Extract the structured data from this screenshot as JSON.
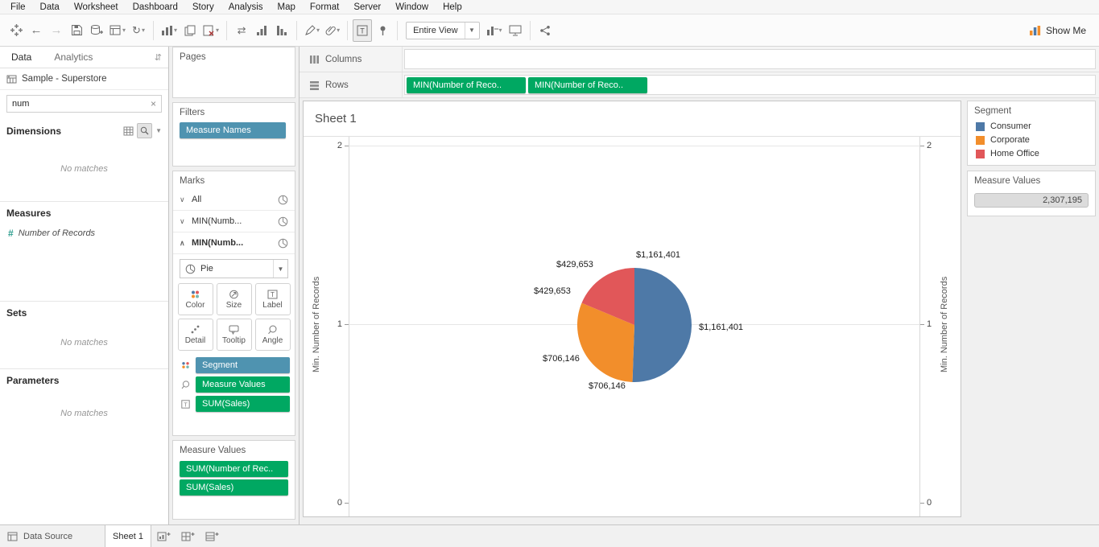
{
  "colors": {
    "pill_green": "#00a862",
    "pill_blue": "#4f93b0",
    "consumer": "#4e79a7",
    "corporate": "#f28e2b",
    "home_office": "#e15759"
  },
  "menu": {
    "items": [
      "File",
      "Data",
      "Worksheet",
      "Dashboard",
      "Story",
      "Analysis",
      "Map",
      "Format",
      "Server",
      "Window",
      "Help"
    ]
  },
  "toolbar": {
    "view_mode": "Entire View",
    "show_me": "Show Me"
  },
  "data_panel": {
    "tabs": {
      "data": "Data",
      "analytics": "Analytics"
    },
    "connection": "Sample - Superstore",
    "search_value": "num",
    "dimensions": {
      "title": "Dimensions",
      "empty": "No matches"
    },
    "measures": {
      "title": "Measures",
      "item": "Number of Records"
    },
    "sets": {
      "title": "Sets",
      "empty": "No matches"
    },
    "parameters": {
      "title": "Parameters",
      "empty": "No matches"
    }
  },
  "cards": {
    "pages": {
      "title": "Pages"
    },
    "filters": {
      "title": "Filters",
      "pill": "Measure Names"
    },
    "marks": {
      "title": "Marks",
      "layers": [
        {
          "label": "All"
        },
        {
          "label": "MIN(Numb..."
        },
        {
          "label": "MIN(Numb..."
        }
      ],
      "mark_type": "Pie",
      "buttons": {
        "color": "Color",
        "size": "Size",
        "label": "Label",
        "detail": "Detail",
        "tooltip": "Tooltip",
        "angle": "Angle"
      },
      "pills": [
        {
          "label": "Segment"
        },
        {
          "label": "Measure Values"
        },
        {
          "label": "SUM(Sales)"
        }
      ]
    },
    "measure_values": {
      "title": "Measure Values",
      "pills": [
        {
          "label": "SUM(Number of Rec.."
        },
        {
          "label": "SUM(Sales)"
        }
      ]
    }
  },
  "shelves": {
    "columns": {
      "label": "Columns"
    },
    "rows": {
      "label": "Rows",
      "pills": [
        {
          "label": "MIN(Number of Reco.."
        },
        {
          "label": "MIN(Number of Reco.."
        }
      ]
    }
  },
  "sheet": {
    "title": "Sheet 1",
    "axis_title": "Min. Number of Records",
    "ticks": [
      "2",
      "1",
      "0"
    ]
  },
  "chart_data": {
    "type": "pie",
    "title": "Sheet 1",
    "series": [
      {
        "name": "Consumer",
        "value": 1161401,
        "label": "$1,161,401",
        "color": "#4e79a7"
      },
      {
        "name": "Corporate",
        "value": 706146,
        "label": "$706,146",
        "color": "#f28e2b"
      },
      {
        "name": "Home Office",
        "value": 429653,
        "label": "$429,653",
        "color": "#e15759"
      }
    ],
    "total": 2307195,
    "y_axis": {
      "title": "Min. Number of Records",
      "ticks": [
        0,
        1,
        2
      ],
      "range": [
        0,
        2
      ]
    },
    "legend_position": "right",
    "label_positions": [
      {
        "text": "$1,161,401",
        "x": 356,
        "y": 141
      },
      {
        "text": "$1,161,401",
        "x": 434,
        "y": 231
      },
      {
        "text": "$429,653",
        "x": 257,
        "y": 153
      },
      {
        "text": "$429,653",
        "x": 229,
        "y": 186
      },
      {
        "text": "$706,146",
        "x": 240,
        "y": 270
      },
      {
        "text": "$706,146",
        "x": 297,
        "y": 304
      }
    ]
  },
  "legend": {
    "title": "Segment",
    "items": [
      {
        "label": "Consumer",
        "color": "#4e79a7"
      },
      {
        "label": "Corporate",
        "color": "#f28e2b"
      },
      {
        "label": "Home Office",
        "color": "#e15759"
      }
    ]
  },
  "measure_values_legend": {
    "title": "Measure Values",
    "value": "2,307,195"
  },
  "statusbar": {
    "data_source": "Data Source",
    "sheet_tab": "Sheet 1"
  }
}
